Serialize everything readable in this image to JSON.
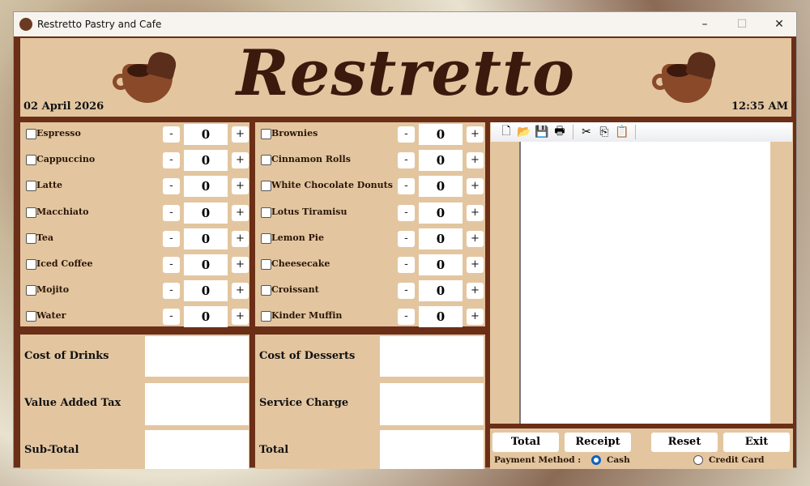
{
  "window": {
    "title": "Restretto Pastry and Cafe",
    "minimize": "–",
    "maximize": "☐",
    "close": "✕"
  },
  "header": {
    "title": "Restretto",
    "date": "02 April 2026",
    "time": "12:35 AM"
  },
  "drinks": [
    {
      "label": "Espresso",
      "qty": "0"
    },
    {
      "label": "Cappuccino",
      "qty": "0"
    },
    {
      "label": "Latte",
      "qty": "0"
    },
    {
      "label": "Macchiato",
      "qty": "0"
    },
    {
      "label": "Tea",
      "qty": "0"
    },
    {
      "label": "Iced Coffee",
      "qty": "0"
    },
    {
      "label": "Mojito",
      "qty": "0"
    },
    {
      "label": "Water",
      "qty": "0"
    }
  ],
  "desserts": [
    {
      "label": "Brownies",
      "qty": "0"
    },
    {
      "label": "Cinnamon Rolls",
      "qty": "0"
    },
    {
      "label": "White Chocolate Donuts",
      "qty": "0"
    },
    {
      "label": "Lotus Tiramisu",
      "qty": "0"
    },
    {
      "label": "Lemon Pie",
      "qty": "0"
    },
    {
      "label": "Cheesecake",
      "qty": "0"
    },
    {
      "label": "Croissant",
      "qty": "0"
    },
    {
      "label": "Kinder Muffin",
      "qty": "0"
    }
  ],
  "stepper": {
    "minus": "-",
    "plus": "+"
  },
  "costs_left": [
    {
      "label": "Cost of Drinks",
      "value": ""
    },
    {
      "label": "Value Added Tax",
      "value": ""
    },
    {
      "label": "Sub-Total",
      "value": ""
    }
  ],
  "costs_right": [
    {
      "label": "Cost of Desserts",
      "value": ""
    },
    {
      "label": "Service Charge",
      "value": ""
    },
    {
      "label": "Total",
      "value": ""
    }
  ],
  "toolbar": [
    {
      "icon": "new-icon",
      "glyph": "🗋"
    },
    {
      "icon": "open-icon",
      "glyph": "📂"
    },
    {
      "icon": "save-icon",
      "glyph": "💾"
    },
    {
      "icon": "print-icon",
      "glyph": "🖶"
    },
    {
      "icon": "cut-icon",
      "glyph": "✂"
    },
    {
      "icon": "copy-icon",
      "glyph": "⎘"
    },
    {
      "icon": "paste-icon",
      "glyph": "📋"
    }
  ],
  "receipt_text": "",
  "buttons": {
    "total": "Total",
    "receipt": "Receipt",
    "reset": "Reset",
    "exit": "Exit"
  },
  "payment": {
    "label": "Payment Method :",
    "cash": "Cash",
    "credit": "Credit Card",
    "selected": "Cash"
  }
}
